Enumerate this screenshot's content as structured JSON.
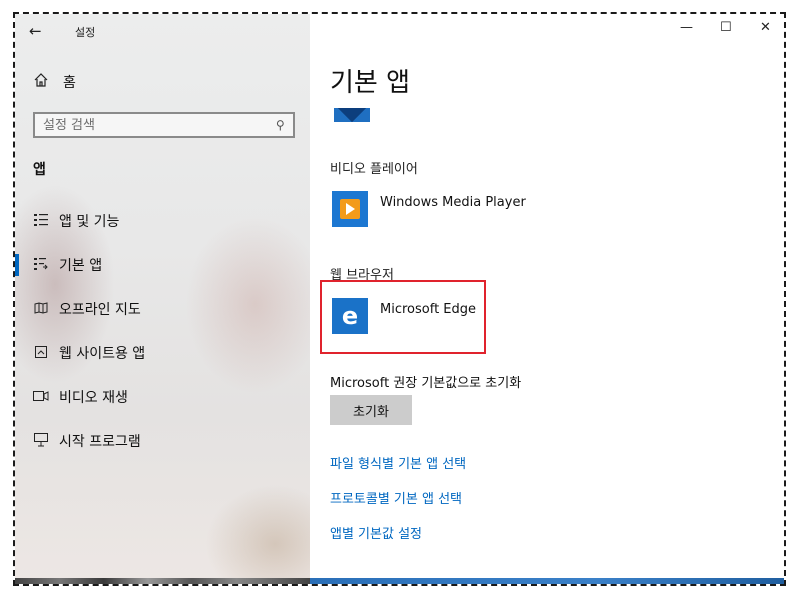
{
  "window": {
    "title": "설정",
    "back_icon": "arrow-left-icon",
    "controls": {
      "minimize": "—",
      "maximize": "☐",
      "close": "✕"
    }
  },
  "sidebar": {
    "home_label": "홈",
    "search": {
      "placeholder": "설정 검색",
      "value": ""
    },
    "section_title": "앱",
    "items": [
      {
        "label": "앱 및 기능",
        "icon": "apps-features-icon",
        "active": false
      },
      {
        "label": "기본 앱",
        "icon": "default-apps-icon",
        "active": true
      },
      {
        "label": "오프라인 지도",
        "icon": "offline-maps-icon",
        "active": false
      },
      {
        "label": "웹 사이트용 앱",
        "icon": "apps-for-websites-icon",
        "active": false
      },
      {
        "label": "비디오 재생",
        "icon": "video-playback-icon",
        "active": false
      },
      {
        "label": "시작 프로그램",
        "icon": "startup-icon",
        "active": false
      }
    ]
  },
  "main": {
    "title": "기본 앱",
    "video_player": {
      "group_label": "비디오 플레이어",
      "app_name": "Windows Media Player"
    },
    "web_browser": {
      "group_label": "웹 브라우저",
      "app_name": "Microsoft Edge"
    },
    "reset": {
      "label": "Microsoft 권장 기본값으로 초기화",
      "button": "초기화"
    },
    "links": [
      "파일 형식별 기본 앱 선택",
      "프로토콜별 기본 앱 선택",
      "앱별 기본값 설정"
    ]
  },
  "colors": {
    "accent": "#0067c0",
    "highlight": "#e0232d",
    "edge_tile": "#1a72c8",
    "wmp_tile": "#1c77d1"
  }
}
